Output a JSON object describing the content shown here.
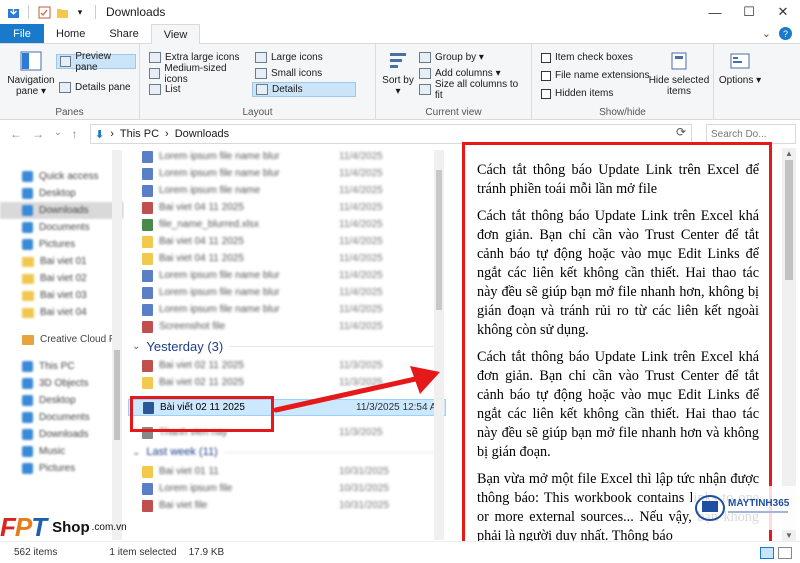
{
  "window": {
    "title": "Downloads",
    "controls": [
      "—",
      "☐",
      "✕"
    ]
  },
  "tabs": [
    {
      "label": "File"
    },
    {
      "label": "Home"
    },
    {
      "label": "Share"
    },
    {
      "label": "View"
    }
  ],
  "ribbon": {
    "panes": {
      "navigation_pane": "Navigation pane ▾",
      "preview_pane": "Preview pane",
      "details_pane": "Details pane",
      "label": "Panes"
    },
    "layout": {
      "items": [
        "Extra large icons",
        "Large icons",
        "Medium-sized icons",
        "Small icons",
        "List",
        "Details"
      ],
      "label": "Layout"
    },
    "current_view": {
      "sort_by": "Sort by ▾",
      "group_by": "Group by ▾",
      "add_columns": "Add columns ▾",
      "size_all": "Size all columns to fit",
      "label": "Current view"
    },
    "show_hide": {
      "item_check_boxes": "Item check boxes",
      "file_name_extensions": "File name extensions",
      "hidden_items": "Hidden items",
      "hide_selected": "Hide selected items",
      "label": "Show/hide"
    },
    "options": "Options ▾"
  },
  "address": {
    "breadcrumb": [
      "This PC",
      "Downloads"
    ],
    "search_placeholder": "Search Do..."
  },
  "navpane": {
    "items": [
      "Quick access",
      "Desktop",
      "Downloads",
      "Documents",
      "Pictures",
      "Bai viet 01",
      "Bai viet 02",
      "Bai viet 03",
      "Bai viet 04",
      "Creative Cloud Files",
      "This PC",
      "3D Objects",
      "Desktop",
      "Documents",
      "Downloads",
      "Music",
      "Pictures"
    ],
    "visible_items": [
      "Creative Cloud F"
    ]
  },
  "filelist": {
    "group_header": "Yesterday (3)",
    "selected_file": {
      "name": "Bài viết 02 11 2025",
      "date": "11/3/2025 12:54 A"
    }
  },
  "preview": {
    "paragraphs": [
      "Cách tắt thông báo Update Link trên Excel để tránh phiền toái mỗi lần mở file",
      "Cách tắt thông báo Update Link trên Excel khá đơn giản. Bạn chỉ cần vào Trust Center để tắt cảnh báo tự động hoặc vào mục Edit Links để ngắt các liên kết không cần thiết. Hai thao tác này đều sẽ giúp bạn mở file nhanh hơn, không bị gián đoạn và tránh rủi ro từ các liên kết ngoài không còn sử dụng.",
      "Cách tắt thông báo Update Link trên Excel khá đơn giản. Bạn chỉ cần vào Trust Center để tắt cảnh báo tự động hoặc vào mục Edit Links để ngắt các liên kết không cần thiết. Hai thao tác này đều sẽ giúp bạn mở file nhanh hơn và không bị gián đoạn.",
      "Bạn vừa mở một file Excel thì lập tức nhận được thông báo: This workbook contains links to one or more external sources... Nếu vậy, bạn không phải là người duy nhất. Thông báo"
    ]
  },
  "status": {
    "items_count": "562 items",
    "selected": "1 item selected",
    "size": "17.9 KB"
  },
  "watermark": {
    "fpt": "FPT",
    "shop": "Shop",
    "domain": ".com.vn",
    "maytinh": "MAYTINH365"
  },
  "colors": {
    "accent": "#1979ca",
    "highlight_red": "#e51919",
    "selection": "#cce8ff"
  }
}
